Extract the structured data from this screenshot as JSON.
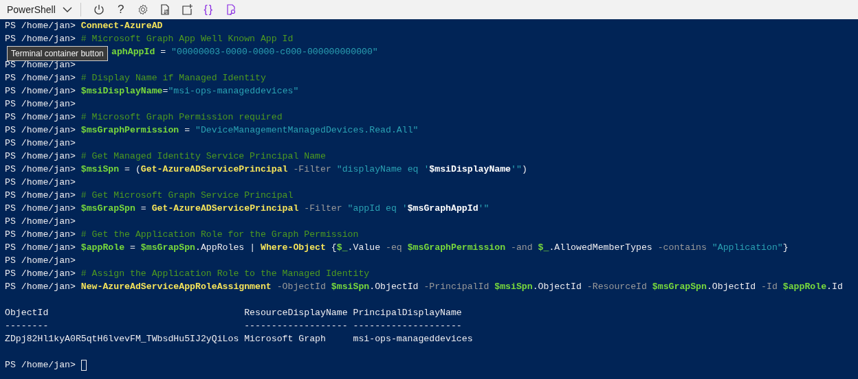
{
  "toolbar": {
    "shell_selector": "PowerShell",
    "buttons": [
      {
        "kind": "power"
      },
      {
        "kind": "help",
        "label": "?"
      },
      {
        "kind": "settings"
      },
      {
        "kind": "upload"
      },
      {
        "kind": "new-session"
      },
      {
        "kind": "editor",
        "label": "{}"
      },
      {
        "kind": "web-preview"
      }
    ]
  },
  "tooltip": {
    "text": "Terminal container button"
  },
  "terminal": {
    "lines": [
      {
        "kind": "code",
        "segments": [
          {
            "kind": "prompt",
            "text": "PS /home/jan> "
          },
          {
            "kind": "command",
            "text": "Connect-AzureAD"
          }
        ]
      },
      {
        "kind": "code",
        "segments": [
          {
            "kind": "prompt",
            "text": "PS /home/jan> "
          },
          {
            "kind": "comment",
            "text": "# Microsoft Graph App Well Known App Id"
          }
        ]
      },
      {
        "kind": "covered",
        "segments": [
          {
            "kind": "variable",
            "text": "aphAppId"
          },
          {
            "kind": "plain",
            "text": " = "
          },
          {
            "kind": "string",
            "text": "\"00000003-0000-0000-c000-000000000000\""
          }
        ]
      },
      {
        "kind": "code",
        "segments": [
          {
            "kind": "prompt",
            "text": "PS /home/jan>"
          }
        ]
      },
      {
        "kind": "code",
        "segments": [
          {
            "kind": "prompt",
            "text": "PS /home/jan> "
          },
          {
            "kind": "comment",
            "text": "# Display Name if Managed Identity"
          }
        ]
      },
      {
        "kind": "code",
        "segments": [
          {
            "kind": "prompt",
            "text": "PS /home/jan> "
          },
          {
            "kind": "variable",
            "text": "$msiDisplayName"
          },
          {
            "kind": "plain",
            "text": "="
          },
          {
            "kind": "string",
            "text": "\"msi-ops-manageddevices\""
          }
        ]
      },
      {
        "kind": "code",
        "segments": [
          {
            "kind": "prompt",
            "text": "PS /home/jan>"
          }
        ]
      },
      {
        "kind": "code",
        "segments": [
          {
            "kind": "prompt",
            "text": "PS /home/jan> "
          },
          {
            "kind": "comment",
            "text": "# Microsoft Graph Permission required"
          }
        ]
      },
      {
        "kind": "code",
        "segments": [
          {
            "kind": "prompt",
            "text": "PS /home/jan> "
          },
          {
            "kind": "variable",
            "text": "$msGraphPermission"
          },
          {
            "kind": "plain",
            "text": " = "
          },
          {
            "kind": "string",
            "text": "\"DeviceManagementManagedDevices.Read.All\""
          }
        ]
      },
      {
        "kind": "code",
        "segments": [
          {
            "kind": "prompt",
            "text": "PS /home/jan>"
          }
        ]
      },
      {
        "kind": "code",
        "segments": [
          {
            "kind": "prompt",
            "text": "PS /home/jan> "
          },
          {
            "kind": "comment",
            "text": "# Get Managed Identity Service Principal Name"
          }
        ]
      },
      {
        "kind": "code",
        "segments": [
          {
            "kind": "prompt",
            "text": "PS /home/jan> "
          },
          {
            "kind": "variable",
            "text": "$msiSpn"
          },
          {
            "kind": "plain",
            "text": " = ("
          },
          {
            "kind": "command",
            "text": "Get-AzureADServicePrincipal"
          },
          {
            "kind": "parameter",
            "text": " -Filter "
          },
          {
            "kind": "string",
            "text": "\"displayName eq '"
          },
          {
            "kind": "interpolation",
            "text": "$msiDisplayName"
          },
          {
            "kind": "string",
            "text": "'\""
          },
          {
            "kind": "plain",
            "text": ")"
          }
        ]
      },
      {
        "kind": "code",
        "segments": [
          {
            "kind": "prompt",
            "text": "PS /home/jan>"
          }
        ]
      },
      {
        "kind": "code",
        "segments": [
          {
            "kind": "prompt",
            "text": "PS /home/jan> "
          },
          {
            "kind": "comment",
            "text": "# Get Microsoft Graph Service Principal"
          }
        ]
      },
      {
        "kind": "code",
        "segments": [
          {
            "kind": "prompt",
            "text": "PS /home/jan> "
          },
          {
            "kind": "variable",
            "text": "$msGrapSpn"
          },
          {
            "kind": "plain",
            "text": " = "
          },
          {
            "kind": "command",
            "text": "Get-AzureADServicePrincipal"
          },
          {
            "kind": "parameter",
            "text": " -Filter "
          },
          {
            "kind": "string",
            "text": "\"appId eq '"
          },
          {
            "kind": "interpolation",
            "text": "$msGraphAppId"
          },
          {
            "kind": "string",
            "text": "'\""
          }
        ]
      },
      {
        "kind": "code",
        "segments": [
          {
            "kind": "prompt",
            "text": "PS /home/jan>"
          }
        ]
      },
      {
        "kind": "code",
        "segments": [
          {
            "kind": "prompt",
            "text": "PS /home/jan> "
          },
          {
            "kind": "comment",
            "text": "# Get the Application Role for the Graph Permission"
          }
        ]
      },
      {
        "kind": "code",
        "segments": [
          {
            "kind": "prompt",
            "text": "PS /home/jan> "
          },
          {
            "kind": "variable",
            "text": "$appRole"
          },
          {
            "kind": "plain",
            "text": " = "
          },
          {
            "kind": "variable",
            "text": "$msGrapSpn"
          },
          {
            "kind": "plain",
            "text": ".AppRoles | "
          },
          {
            "kind": "command",
            "text": "Where-Object"
          },
          {
            "kind": "plain",
            "text": " {"
          },
          {
            "kind": "variable",
            "text": "$_"
          },
          {
            "kind": "plain",
            "text": ".Value"
          },
          {
            "kind": "parameter",
            "text": " -eq "
          },
          {
            "kind": "variable",
            "text": "$msGraphPermission"
          },
          {
            "kind": "parameter",
            "text": " -and "
          },
          {
            "kind": "variable",
            "text": "$_"
          },
          {
            "kind": "plain",
            "text": ".AllowedMemberTypes"
          },
          {
            "kind": "parameter",
            "text": " -contains "
          },
          {
            "kind": "string",
            "text": "\"Application\""
          },
          {
            "kind": "plain",
            "text": "}"
          }
        ]
      },
      {
        "kind": "code",
        "segments": [
          {
            "kind": "prompt",
            "text": "PS /home/jan>"
          }
        ]
      },
      {
        "kind": "code",
        "segments": [
          {
            "kind": "prompt",
            "text": "PS /home/jan> "
          },
          {
            "kind": "comment",
            "text": "# Assign the Application Role to the Managed Identity"
          }
        ]
      },
      {
        "kind": "code",
        "segments": [
          {
            "kind": "prompt",
            "text": "PS /home/jan> "
          },
          {
            "kind": "command",
            "text": "New-AzureAdServiceAppRoleAssignment"
          },
          {
            "kind": "parameter",
            "text": " -ObjectId "
          },
          {
            "kind": "variable",
            "text": "$msiSpn"
          },
          {
            "kind": "plain",
            "text": ".ObjectId"
          },
          {
            "kind": "parameter",
            "text": " -PrincipalId "
          },
          {
            "kind": "variable",
            "text": "$msiSpn"
          },
          {
            "kind": "plain",
            "text": ".ObjectId"
          },
          {
            "kind": "parameter",
            "text": " -ResourceId "
          },
          {
            "kind": "variable",
            "text": "$msGrapSpn"
          },
          {
            "kind": "plain",
            "text": ".ObjectId"
          },
          {
            "kind": "parameter",
            "text": " -Id "
          },
          {
            "kind": "variable",
            "text": "$appRole"
          },
          {
            "kind": "plain",
            "text": ".Id"
          }
        ]
      },
      {
        "kind": "blank"
      },
      {
        "kind": "code",
        "segments": [
          {
            "kind": "output",
            "text": "ObjectId                                    ResourceDisplayName PrincipalDisplayName"
          }
        ]
      },
      {
        "kind": "code",
        "segments": [
          {
            "kind": "output",
            "text": "--------                                    ------------------- --------------------"
          }
        ]
      },
      {
        "kind": "code",
        "segments": [
          {
            "kind": "output",
            "text": "ZDpj82Hl1kyA0R5qtH6lvevFM_TWbsdHu5IJ2yQiLos Microsoft Graph     msi-ops-manageddevices"
          }
        ]
      },
      {
        "kind": "blank"
      },
      {
        "kind": "code",
        "cursor": true,
        "segments": [
          {
            "kind": "prompt",
            "text": "PS /home/jan> "
          }
        ]
      }
    ]
  }
}
